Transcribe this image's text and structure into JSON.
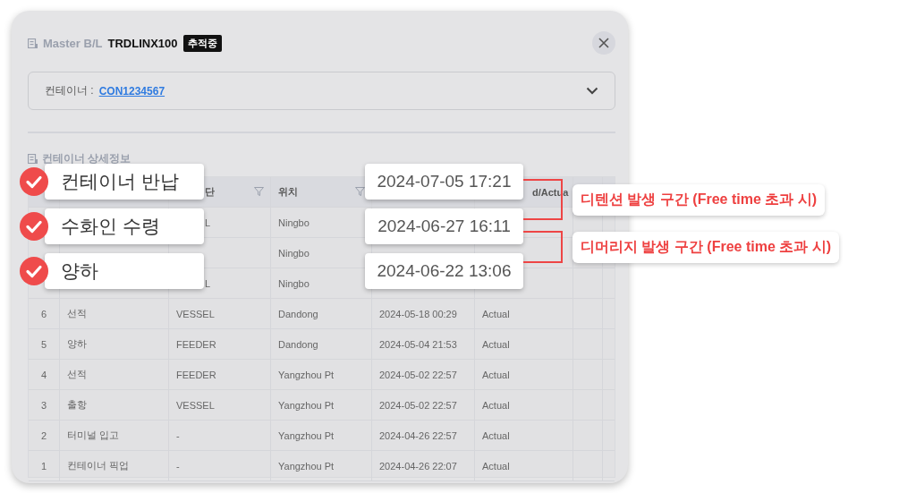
{
  "dialog": {
    "label": "Master B/L",
    "bl_number": "TRDLINX100",
    "badge": "추적중"
  },
  "container_select": {
    "label": "컨테이너 :",
    "value": "CON1234567"
  },
  "section_title": "컨테이너 상세정보",
  "table": {
    "columns": [
      {
        "kind": "blank"
      },
      {
        "kind": "blank"
      },
      {
        "kind": "cut",
        "label": "단",
        "filter": true
      },
      {
        "kind": "plain",
        "label": "위치",
        "filter": true
      },
      {
        "kind": "blank"
      },
      {
        "kind": "cut",
        "label": "d/Actua"
      },
      {
        "kind": "blank"
      }
    ],
    "rows": [
      {
        "mode": "L",
        "mode_cut": true,
        "location": "Ningbo"
      },
      {
        "location": "Ningbo"
      },
      {
        "mode": "L",
        "mode_cut": true,
        "location": "Ningbo"
      },
      {
        "no": "6",
        "event": "선적",
        "mode": "VESSEL",
        "location": "Dandong",
        "time": "2024-05-18 00:29",
        "status": "Actual"
      },
      {
        "no": "5",
        "event": "양하",
        "mode": "FEEDER",
        "location": "Dandong",
        "time": "2024-05-04 21:53",
        "status": "Actual"
      },
      {
        "no": "4",
        "event": "선적",
        "mode": "FEEDER",
        "location": "Yangzhou Pt",
        "time": "2024-05-02 22:57",
        "status": "Actual"
      },
      {
        "no": "3",
        "event": "출항",
        "mode": "VESSEL",
        "location": "Yangzhou Pt",
        "time": "2024-05-02 22:57",
        "status": "Actual"
      },
      {
        "no": "2",
        "event": "터미널 입고",
        "mode": "-",
        "location": "Yangzhou Pt",
        "time": "2024-04-26 22:57",
        "status": "Actual"
      },
      {
        "no": "1",
        "event": "컨테이너 픽업",
        "mode": "-",
        "location": "Yangzhou Pt",
        "time": "2024-04-26 22:07",
        "status": "Actual"
      }
    ]
  },
  "events": [
    {
      "label": "컨테이너 반납",
      "checked": true,
      "time": "2024-07-05 17:21"
    },
    {
      "label": "수화인 수령",
      "checked": true,
      "time": "2024-06-27 16:11"
    },
    {
      "label": "양하",
      "checked": true,
      "time": "2024-06-22 13:06"
    }
  ],
  "ranges": [
    {
      "label": "디텐션 발생 구간 (Free time 초과 시)"
    },
    {
      "label": "디머리지 발생 구간 (Free time 초과 시)"
    }
  ]
}
